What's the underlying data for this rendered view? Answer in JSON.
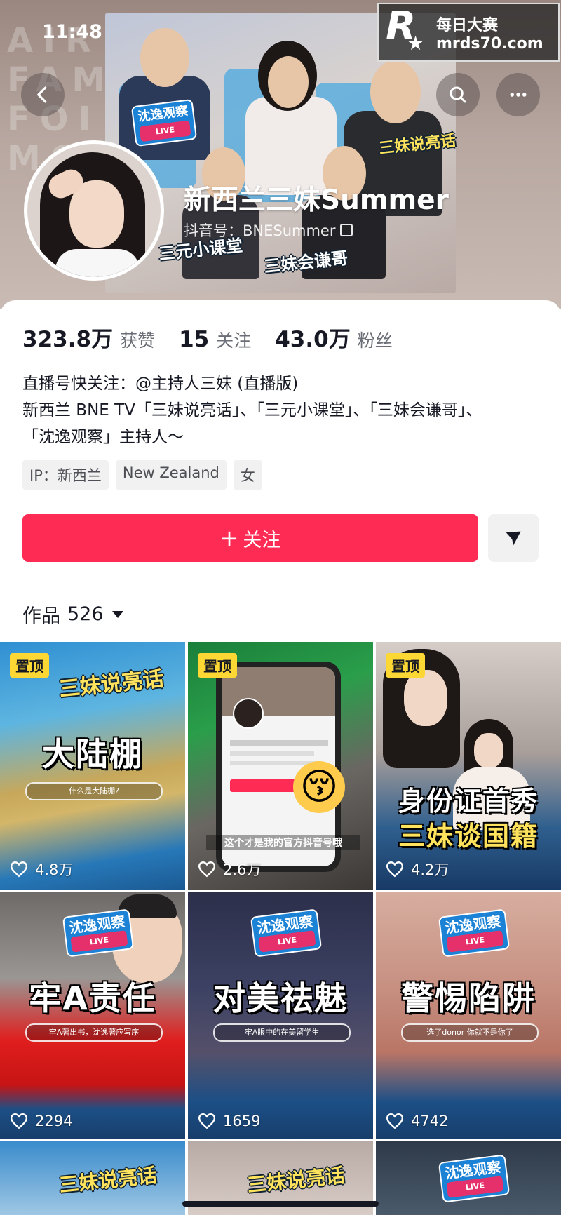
{
  "status_bar": {
    "time": "11:48"
  },
  "watermark": {
    "line1": "每日大赛",
    "line2": "mrds70.com"
  },
  "banner": {
    "background_text": "AIR FAM FOI MON",
    "badges": [
      "沈逸观察",
      "三妹说亮话",
      "三元小课堂",
      "三妹会谦哥"
    ],
    "badge_live": "LIVE"
  },
  "profile": {
    "name": "新西兰三妹Summer",
    "douyin_id": "抖音号：BNESummer",
    "stats": [
      {
        "value": "323.8万",
        "label": "获赞"
      },
      {
        "value": "15",
        "label": "关注"
      },
      {
        "value": "43.0万",
        "label": "粉丝"
      }
    ],
    "bio": [
      "直播号快关注：@主持人三妹 (直播版)",
      "新西兰 BNE TV「三妹说亮话」、「三元小课堂」、「三妹会谦哥」、",
      "「沈逸观察」主持人～"
    ],
    "tags": [
      "IP：新西兰",
      "New Zealand",
      "女"
    ],
    "follow_label": "关注",
    "works_label": "作品",
    "works_count": "526"
  },
  "videos": [
    {
      "title": "大陆棚",
      "search": "什么是大陆棚?",
      "likes": "4.8万",
      "pinned": true
    },
    {
      "title": "",
      "caption": "这个才是我的官方抖音号哦",
      "likes": "2.6万",
      "pinned": true
    },
    {
      "title": "身份证首秀",
      "subtitle": "三妹谈国籍",
      "likes": "4.2万",
      "pinned": true
    },
    {
      "title": "牢A责任",
      "search": "牢A著出书，沈逸著应写序",
      "likes": "2294",
      "pinned": false
    },
    {
      "title": "对美祛魅",
      "search": "牢A眼中的在美留学生",
      "likes": "1659",
      "pinned": false
    },
    {
      "title": "警惕陷阱",
      "search": "选了donor 你就不是你了",
      "likes": "4742",
      "pinned": false
    }
  ],
  "pin_label": "置顶",
  "colors": {
    "accent": "#fe2c55",
    "pin": "#fdd835",
    "text": "#161823"
  }
}
